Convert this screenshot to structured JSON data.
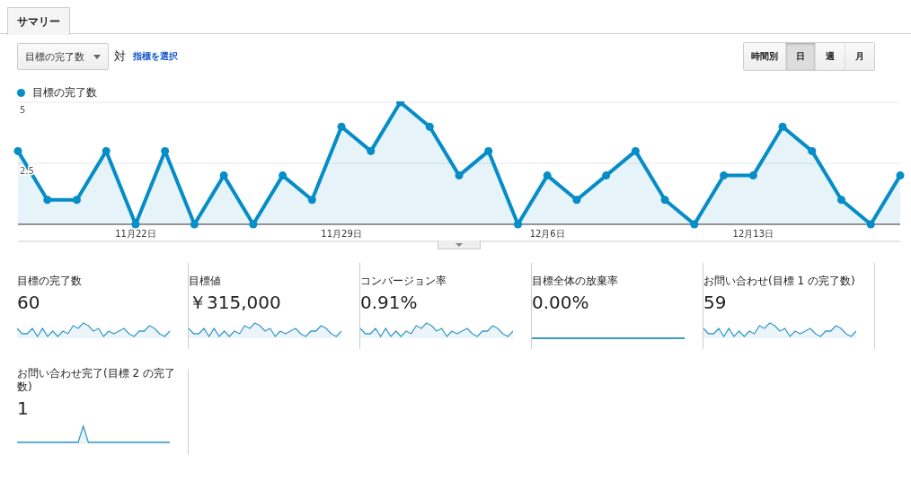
{
  "tabs": [
    {
      "label": "サマリー",
      "selected": true
    }
  ],
  "metric_dropdown": {
    "value": "目標の完了数"
  },
  "versus": "対",
  "select_metric_link": "指標を選択",
  "period_buttons": [
    {
      "label": "時間別",
      "selected": false
    },
    {
      "label": "日",
      "selected": true
    },
    {
      "label": "週",
      "selected": false
    },
    {
      "label": "月",
      "selected": false
    }
  ],
  "chart_data": {
    "type": "area",
    "categories": [
      null,
      null,
      null,
      null,
      "11月22日",
      null,
      null,
      null,
      null,
      null,
      null,
      "11月29日",
      null,
      null,
      null,
      null,
      null,
      null,
      "12月6日",
      null,
      null,
      null,
      null,
      null,
      null,
      "12月13日",
      null,
      null,
      null,
      null,
      null
    ],
    "series": [
      {
        "name": "目標の完了数",
        "color": "#058dc7",
        "values": [
          3,
          1,
          1,
          3,
          0,
          3,
          0,
          2,
          0,
          2,
          1,
          4,
          3,
          5,
          4,
          2,
          3,
          0,
          2,
          1,
          2,
          3,
          1,
          0,
          2,
          2,
          4,
          3,
          1,
          0,
          2
        ]
      }
    ],
    "ylim": [
      0,
      5
    ],
    "yticks": [
      {
        "value": 2.5,
        "label": "2.5"
      },
      {
        "value": 5,
        "label": "5"
      }
    ]
  },
  "metrics": [
    {
      "label": "目標の完了数",
      "value": "60",
      "kind": "series"
    },
    {
      "label": "目標値",
      "value": "￥315,000",
      "kind": "series"
    },
    {
      "label": "コンバージョン率",
      "value": "0.91%",
      "kind": "series"
    },
    {
      "label": "目標全体の放棄率",
      "value": "0.00%",
      "kind": "flat"
    },
    {
      "label": "お問い合わせ(目標 1 の完了数)",
      "value": "59",
      "kind": "series"
    },
    {
      "label": "お問い合わせ完了(目標 2 の完了数)",
      "value": "1",
      "kind": "spike"
    }
  ]
}
